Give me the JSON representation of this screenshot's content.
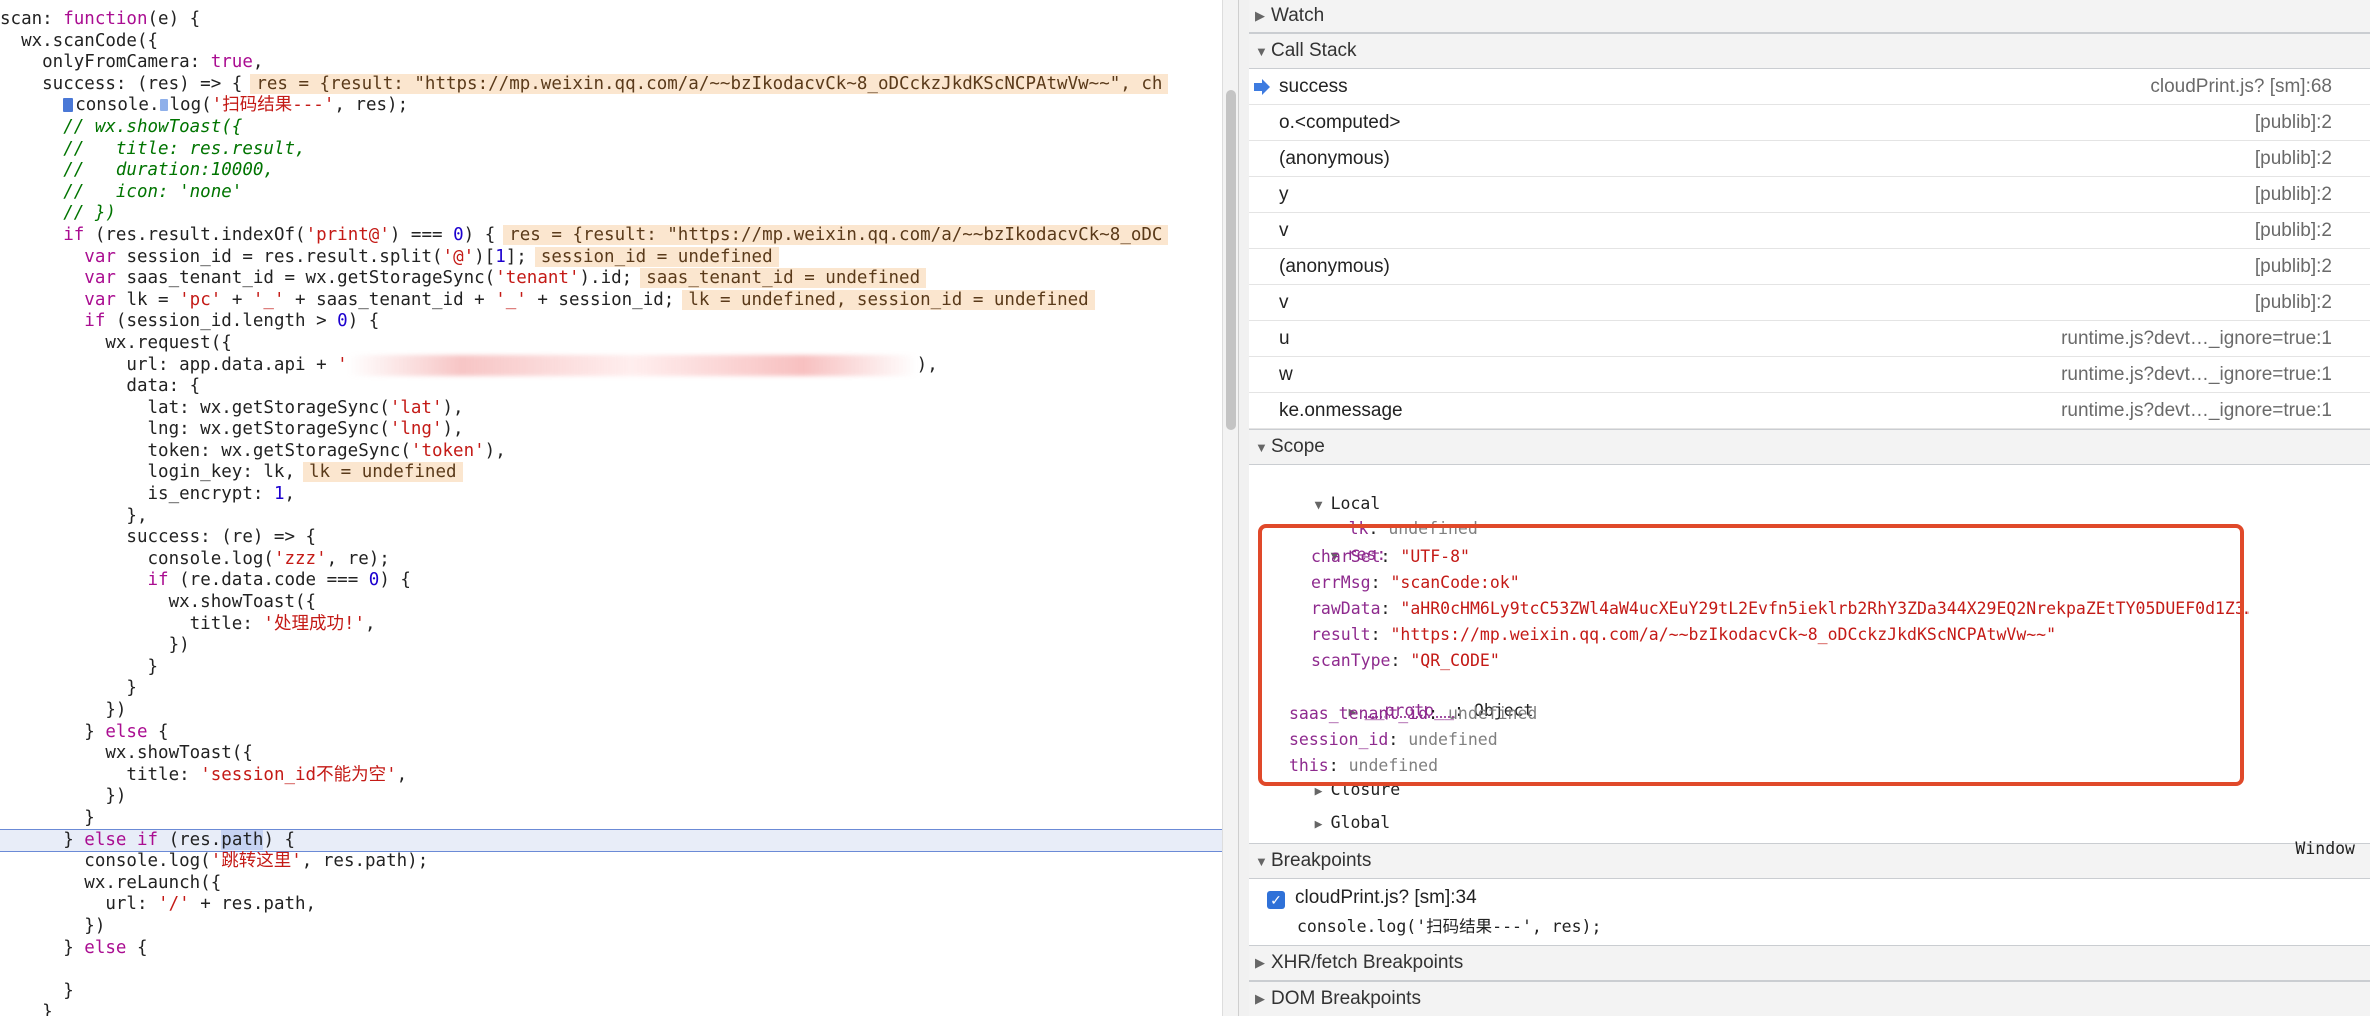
{
  "editor": {
    "lines": [
      [
        {
          "t": "scan: "
        },
        {
          "t": "function",
          "c": "kw"
        },
        {
          "t": "(e) {"
        }
      ],
      [
        {
          "t": "  wx.scanCode({"
        }
      ],
      [
        {
          "t": "    onlyFromCamera: "
        },
        {
          "t": "true",
          "c": "kw"
        },
        {
          "t": ","
        }
      ],
      [
        {
          "t": "    success: (res) => {"
        },
        {
          "t": "res = {result: \"https://mp.weixin.qq.com/a/~~bzIkodacvCk~8_oDCckzJkdKScNCPAtwVw~~\", ch",
          "c": "iv"
        }
      ],
      [
        {
          "t": "      "
        },
        {
          "t": "",
          "c": "bpm"
        },
        {
          "t": "console."
        },
        {
          "t": "",
          "c": "bpm2"
        },
        {
          "t": "log("
        },
        {
          "t": "'扫码结果---'",
          "c": "str"
        },
        {
          "t": ", res);"
        }
      ],
      [
        {
          "t": "      // wx.showToast({",
          "c": "cm"
        }
      ],
      [
        {
          "t": "      //   title: res.result,",
          "c": "cm"
        }
      ],
      [
        {
          "t": "      //   duration:10000,",
          "c": "cm"
        }
      ],
      [
        {
          "t": "      //   icon: 'none'",
          "c": "cm"
        }
      ],
      [
        {
          "t": "      // })",
          "c": "cm"
        }
      ],
      [
        {
          "t": "      "
        },
        {
          "t": "if",
          "c": "kw"
        },
        {
          "t": " (res.result.indexOf("
        },
        {
          "t": "'print@'",
          "c": "str"
        },
        {
          "t": ") === "
        },
        {
          "t": "0",
          "c": "num"
        },
        {
          "t": ") {"
        },
        {
          "t": "res = {result: \"https://mp.weixin.qq.com/a/~~bzIkodacvCk~8_oDC",
          "c": "iv"
        }
      ],
      [
        {
          "t": "        "
        },
        {
          "t": "var",
          "c": "kw"
        },
        {
          "t": " session_id = res.result.split("
        },
        {
          "t": "'@'",
          "c": "str"
        },
        {
          "t": ")["
        },
        {
          "t": "1",
          "c": "num"
        },
        {
          "t": "];"
        },
        {
          "t": "session_id = undefined",
          "c": "iv"
        }
      ],
      [
        {
          "t": "        "
        },
        {
          "t": "var",
          "c": "kw"
        },
        {
          "t": " saas_tenant_id = wx.getStorageSync("
        },
        {
          "t": "'tenant'",
          "c": "str"
        },
        {
          "t": ").id;"
        },
        {
          "t": "saas_tenant_id = undefined",
          "c": "iv"
        }
      ],
      [
        {
          "t": "        "
        },
        {
          "t": "var",
          "c": "kw"
        },
        {
          "t": " lk = "
        },
        {
          "t": "'pc'",
          "c": "str"
        },
        {
          "t": " + "
        },
        {
          "t": "'_'",
          "c": "str"
        },
        {
          "t": " + saas_tenant_id + "
        },
        {
          "t": "'_'",
          "c": "str"
        },
        {
          "t": " + session_id;"
        },
        {
          "t": "lk = undefined, session_id = undefined",
          "c": "iv"
        }
      ],
      [
        {
          "t": "        "
        },
        {
          "t": "if",
          "c": "kw"
        },
        {
          "t": " (session_id.length > "
        },
        {
          "t": "0",
          "c": "num"
        },
        {
          "t": ") {"
        }
      ],
      [
        {
          "t": "          wx.request({"
        }
      ],
      [
        {
          "t": "            url: app.data.api + "
        },
        {
          "t": "'",
          "c": "str"
        },
        {
          "t": "xxxxxxxxxxxxxxxxxxxxxxxxxxxxxxxxxxxxxxxxxxxxxxxxxxxxxx",
          "c": "redact"
        },
        {
          "t": "),"
        }
      ],
      [
        {
          "t": "            data: {"
        }
      ],
      [
        {
          "t": "              lat: wx.getStorageSync("
        },
        {
          "t": "'lat'",
          "c": "str"
        },
        {
          "t": "),"
        }
      ],
      [
        {
          "t": "              lng: wx.getStorageSync("
        },
        {
          "t": "'lng'",
          "c": "str"
        },
        {
          "t": "),"
        }
      ],
      [
        {
          "t": "              token: wx.getStorageSync("
        },
        {
          "t": "'token'",
          "c": "str"
        },
        {
          "t": "),"
        }
      ],
      [
        {
          "t": "              login_key: lk,"
        },
        {
          "t": "lk = undefined",
          "c": "iv"
        }
      ],
      [
        {
          "t": "              is_encrypt: "
        },
        {
          "t": "1",
          "c": "num"
        },
        {
          "t": ","
        }
      ],
      [
        {
          "t": "            },"
        }
      ],
      [
        {
          "t": "            success: (re) => {"
        }
      ],
      [
        {
          "t": "              console.log("
        },
        {
          "t": "'zzz'",
          "c": "str"
        },
        {
          "t": ", re);"
        }
      ],
      [
        {
          "t": "              "
        },
        {
          "t": "if",
          "c": "kw"
        },
        {
          "t": " (re.data.code === "
        },
        {
          "t": "0",
          "c": "num"
        },
        {
          "t": ") {"
        }
      ],
      [
        {
          "t": "                wx.showToast({"
        }
      ],
      [
        {
          "t": "                  title: "
        },
        {
          "t": "'处理成功!'",
          "c": "str"
        },
        {
          "t": ","
        }
      ],
      [
        {
          "t": "                })"
        }
      ],
      [
        {
          "t": "              }"
        }
      ],
      [
        {
          "t": "            }"
        }
      ],
      [
        {
          "t": "          })"
        }
      ],
      [
        {
          "t": "        } "
        },
        {
          "t": "else",
          "c": "kw"
        },
        {
          "t": " {"
        }
      ],
      [
        {
          "t": "          wx.showToast({"
        }
      ],
      [
        {
          "t": "            title: "
        },
        {
          "t": "'session_id不能为空'",
          "c": "str"
        },
        {
          "t": ","
        }
      ],
      [
        {
          "t": "          })"
        }
      ],
      [
        {
          "t": "        }"
        }
      ],
      [
        {
          "t": "      } "
        },
        {
          "t": "else if",
          "c": "kw"
        },
        {
          "t": " (res."
        },
        {
          "t": "path",
          "c": "sel"
        },
        {
          "t": ") {"
        }
      ],
      [
        {
          "t": "        console.log("
        },
        {
          "t": "'跳转这里'",
          "c": "str"
        },
        {
          "t": ", res.path);"
        }
      ],
      [
        {
          "t": "        wx.reLaunch({"
        }
      ],
      [
        {
          "t": "          url: "
        },
        {
          "t": "'/'",
          "c": "str"
        },
        {
          "t": " + res.path,"
        }
      ],
      [
        {
          "t": "        })"
        }
      ],
      [
        {
          "t": "      } "
        },
        {
          "t": "else",
          "c": "kw"
        },
        {
          "t": " {"
        }
      ],
      [
        {
          "t": ""
        }
      ],
      [
        {
          "t": "      }"
        }
      ],
      [
        {
          "t": "    }"
        }
      ]
    ],
    "highlight_line": 38
  },
  "watch": {
    "label": "Watch"
  },
  "call_stack": {
    "label": "Call Stack",
    "frames": [
      {
        "name": "success",
        "loc": "cloudPrint.js? [sm]:68",
        "current": true
      },
      {
        "name": "o.<computed>",
        "loc": "[publib]:2"
      },
      {
        "name": "(anonymous)",
        "loc": "[publib]:2"
      },
      {
        "name": "y",
        "loc": "[publib]:2"
      },
      {
        "name": "v",
        "loc": "[publib]:2"
      },
      {
        "name": "(anonymous)",
        "loc": "[publib]:2"
      },
      {
        "name": "v",
        "loc": "[publib]:2"
      },
      {
        "name": "u",
        "loc": "runtime.js?devt…_ignore=true:1"
      },
      {
        "name": "w",
        "loc": "runtime.js?devt…_ignore=true:1"
      },
      {
        "name": "ke.onmessage",
        "loc": "runtime.js?devt…_ignore=true:1"
      }
    ]
  },
  "scope": {
    "label": "Scope",
    "local_label": "Local",
    "lk": {
      "key": "lk",
      "val": "undefined"
    },
    "res_key": "res:",
    "res_props": [
      {
        "key": "charSet",
        "val": "\"UTF-8\""
      },
      {
        "key": "errMsg",
        "val": "\"scanCode:ok\""
      },
      {
        "key": "rawData",
        "val": "\"aHR0cHM6Ly9tcC53ZWl4aW4ucXEuY29tL2Evfn5ieklrb2RhY3ZDa344X29EQ2NrekpaZEtTY05DUEF0d1Z3…"
      },
      {
        "key": "result",
        "val": "\"https://mp.weixin.qq.com/a/~~bzIkodacvCk~8_oDCckzJkdKScNCPAtwVw~~\""
      },
      {
        "key": "scanType",
        "val": "\"QR_CODE\""
      }
    ],
    "proto": {
      "key": "__proto__",
      "val": "Object"
    },
    "after": [
      {
        "key": "saas_tenant_id",
        "val": "undefined"
      },
      {
        "key": "session_id",
        "val": "undefined"
      },
      {
        "key": "this",
        "val": "undefined"
      }
    ],
    "closure_label": "Closure",
    "global_label": "Global",
    "global_val": "Window"
  },
  "breakpoints": {
    "label": "Breakpoints",
    "file": "cloudPrint.js? [sm]:34",
    "code": "console.log('扫码结果---', res);",
    "checked": true
  },
  "xhr_label": "XHR/fetch Breakpoints",
  "dom_label": "DOM Breakpoints"
}
